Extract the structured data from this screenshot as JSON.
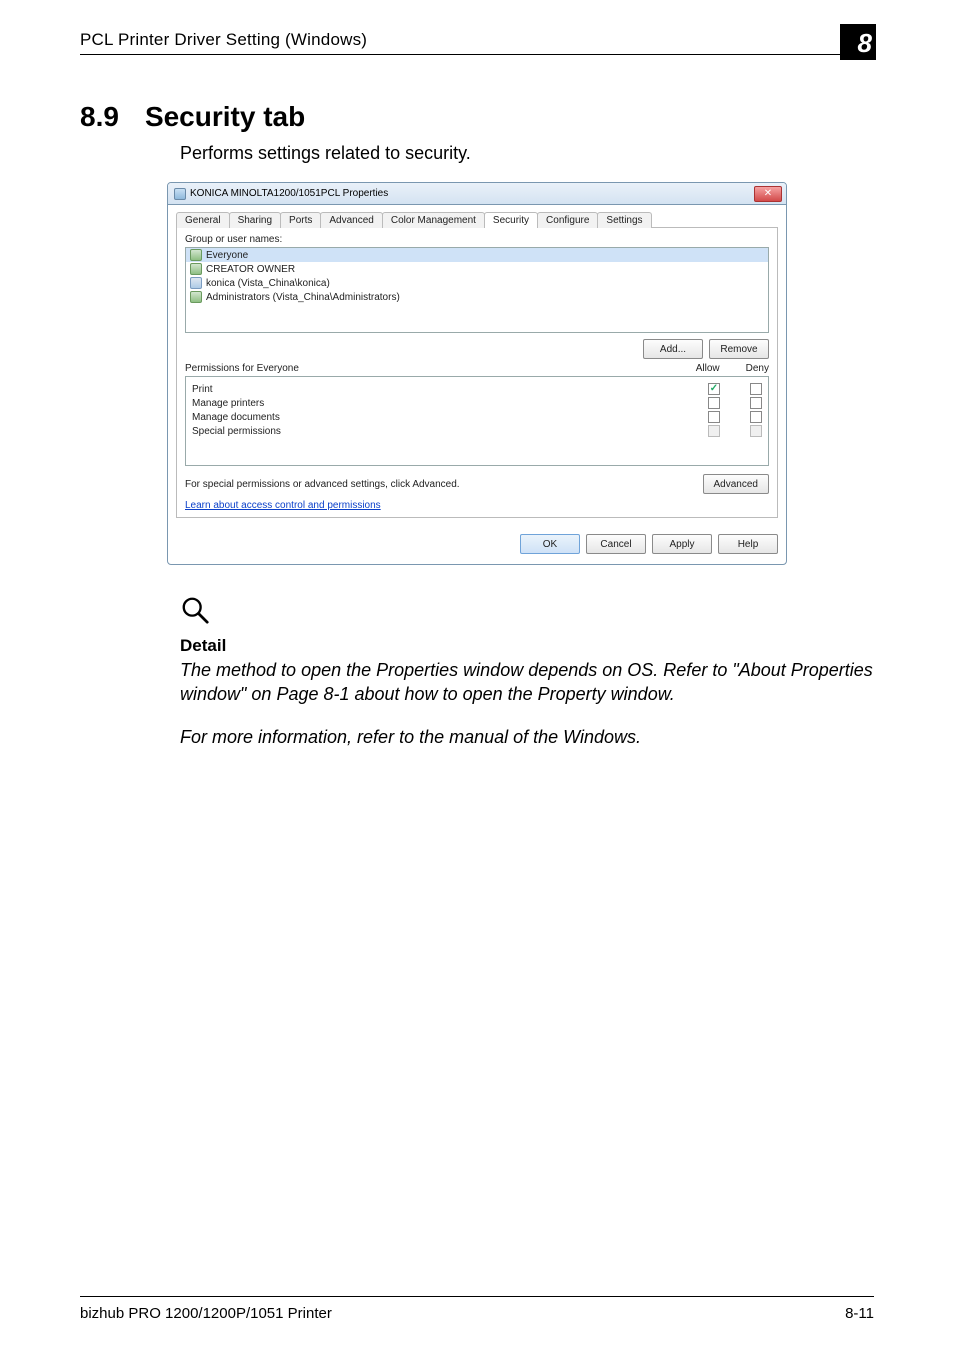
{
  "header": {
    "title": "PCL Printer Driver Setting (Windows)",
    "chapter_number": "8"
  },
  "section": {
    "number": "8.9",
    "title": "Security tab",
    "description": "Performs settings related to security."
  },
  "dialog": {
    "window_title": "KONICA MINOLTA1200/1051PCL Properties",
    "tabs": [
      "General",
      "Sharing",
      "Ports",
      "Advanced",
      "Color Management",
      "Security",
      "Configure",
      "Settings"
    ],
    "active_tab_index": 5,
    "groups_label": "Group or user names:",
    "groups": [
      {
        "name": "Everyone",
        "type": "group",
        "selected": true
      },
      {
        "name": "CREATOR OWNER",
        "type": "group",
        "selected": false
      },
      {
        "name": "konica (Vista_China\\konica)",
        "type": "user",
        "selected": false
      },
      {
        "name": "Administrators (Vista_China\\Administrators)",
        "type": "group",
        "selected": false
      }
    ],
    "add_label": "Add...",
    "remove_label": "Remove",
    "permissions_for_label": "Permissions for Everyone",
    "perm_cols": {
      "allow": "Allow",
      "deny": "Deny"
    },
    "permissions": [
      {
        "name": "Print",
        "allow": true,
        "deny": false
      },
      {
        "name": "Manage printers",
        "allow": false,
        "deny": false
      },
      {
        "name": "Manage documents",
        "allow": false,
        "deny": false
      },
      {
        "name": "Special permissions",
        "allow": false,
        "deny": false,
        "disabled": true
      }
    ],
    "advanced_text": "For special permissions or advanced settings, click Advanced.",
    "advanced_label": "Advanced",
    "learn_link": "Learn about access control and permissions",
    "footer": {
      "ok": "OK",
      "cancel": "Cancel",
      "apply": "Apply",
      "help": "Help"
    }
  },
  "detail": {
    "heading": "Detail",
    "p1": "The method to open the Properties window depends on OS. Refer to \"About Properties window\" on Page 8-1 about how to open the Property window.",
    "p2": "For more information, refer to the manual of the Windows."
  },
  "footer": {
    "left": "bizhub PRO 1200/1200P/1051 Printer",
    "right": "8-11"
  }
}
